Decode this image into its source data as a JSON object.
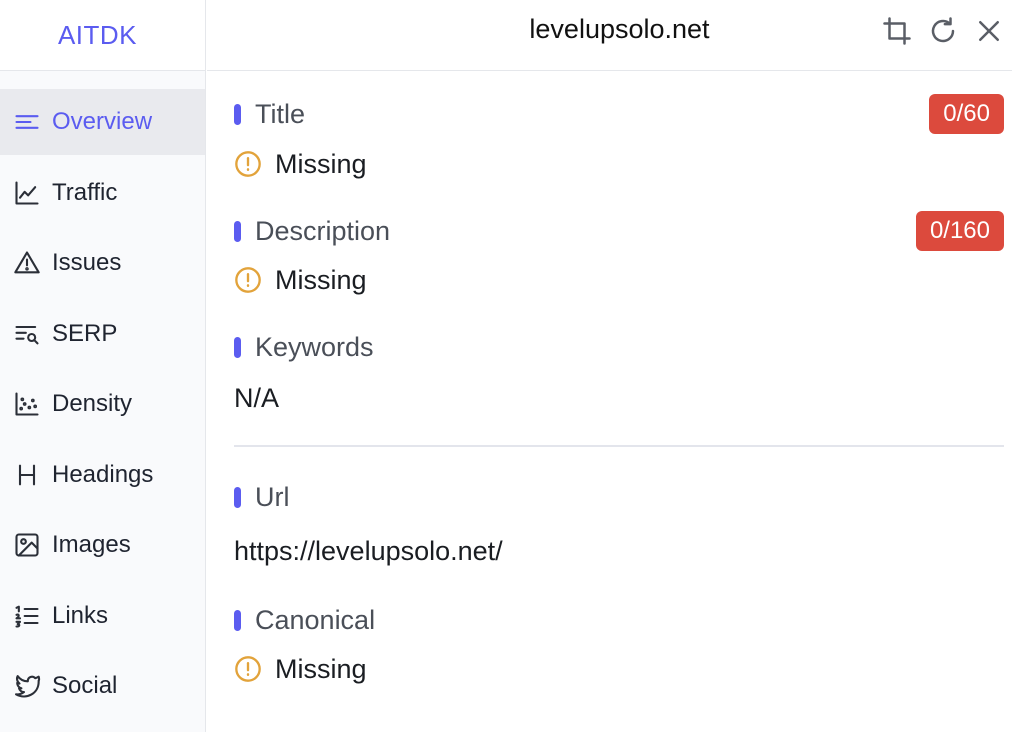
{
  "app": {
    "brand": "AITDK",
    "domain": "levelupsolo.net"
  },
  "toolbar": {
    "icons": [
      "crop-icon",
      "refresh-icon",
      "close-icon"
    ]
  },
  "sidebar": {
    "items": [
      {
        "label": "Overview",
        "icon": "overview-icon",
        "active": true
      },
      {
        "label": "Traffic",
        "icon": "traffic-chart-icon"
      },
      {
        "label": "Issues",
        "icon": "warning-triangle-icon"
      },
      {
        "label": "SERP",
        "icon": "serp-search-icon"
      },
      {
        "label": "Density",
        "icon": "density-scatter-icon"
      },
      {
        "label": "Headings",
        "icon": "heading-h-icon"
      },
      {
        "label": "Images",
        "icon": "image-icon"
      },
      {
        "label": "Links",
        "icon": "list-links-icon"
      },
      {
        "label": "Social",
        "icon": "twitter-bird-icon"
      }
    ]
  },
  "main": {
    "title": {
      "label": "Title",
      "badge": "0/60",
      "value": "Missing"
    },
    "description": {
      "label": "Description",
      "badge": "0/160",
      "value": "Missing"
    },
    "keywords": {
      "label": "Keywords",
      "value": "N/A"
    },
    "url": {
      "label": "Url",
      "value": "https://levelupsolo.net/"
    },
    "canonical": {
      "label": "Canonical",
      "value": "Missing"
    }
  },
  "colors": {
    "accent": "#5b5cf0",
    "badge": "#dc4a3d",
    "warning": "#e2a33b"
  }
}
